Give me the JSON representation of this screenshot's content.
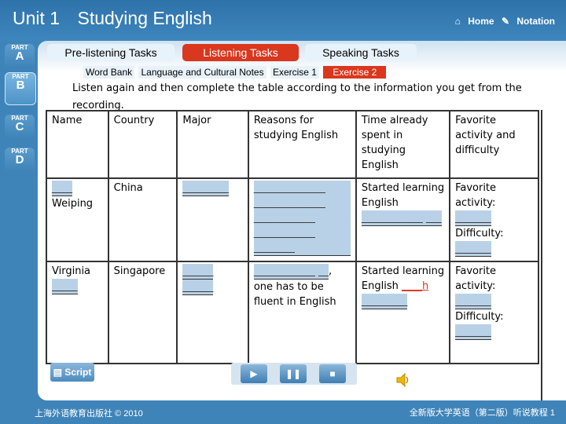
{
  "header": {
    "unit": "Unit 1",
    "title": "Studying English",
    "home_label": "Home",
    "notation_label": "Notation"
  },
  "parts": [
    {
      "small": "PART",
      "letter": "A"
    },
    {
      "small": "PART",
      "letter": "B"
    },
    {
      "small": "PART",
      "letter": "C"
    },
    {
      "small": "PART",
      "letter": "D"
    }
  ],
  "tabs": {
    "pre": "Pre-listening Tasks",
    "listening": "Listening Tasks",
    "speaking": "Speaking Tasks"
  },
  "subtabs": {
    "word_bank": "Word Bank",
    "notes": "Language and Cultural Notes",
    "ex1": "Exercise 1",
    "ex2": "Exercise 2"
  },
  "instruction": "Listen again and then complete the table according to the information you get from the recording.",
  "table": {
    "headers": [
      "Name",
      "Country",
      "Major",
      "Reasons for studying English",
      "Time already spent in studying English",
      "Favorite activity and difficulty"
    ],
    "row1": {
      "name_blank": "____",
      "name": "Weiping",
      "country": "China",
      "major_blank": "_________",
      "reason_blank": "______________ ______________ ____________ ____________ ________",
      "time_text": "Started learning English",
      "time_blank": "____________ ___",
      "fav_label": "Favorite activity:",
      "fav_blank": "_______",
      "diff_label": "Difficulty:",
      "diff_blank": "_______"
    },
    "row2": {
      "name": "Virginia",
      "name_blank": "_____",
      "country": "Singapore",
      "major_blank1": "______",
      "major_blank2": "______",
      "reason_blank": "____________ __",
      "reason_text": ", one has to be fluent in English",
      "time_text": "Started learning English",
      "time_hl": "____h",
      "time_blank": "_________",
      "fav_label": "Favorite activity:",
      "fav_blank": "_______",
      "diff_label": "Difficulty:",
      "diff_blank": "_______"
    }
  },
  "controls": {
    "script": "Script",
    "play": "▶",
    "pause": "❚❚",
    "stop": "■"
  },
  "footer": {
    "left": "上海外语教育出版社 © 2010",
    "right": "全新版大学英语（第二版）听说教程 1"
  },
  "colors": {
    "accent": "#d9371e",
    "frame": "#3f84b9"
  }
}
